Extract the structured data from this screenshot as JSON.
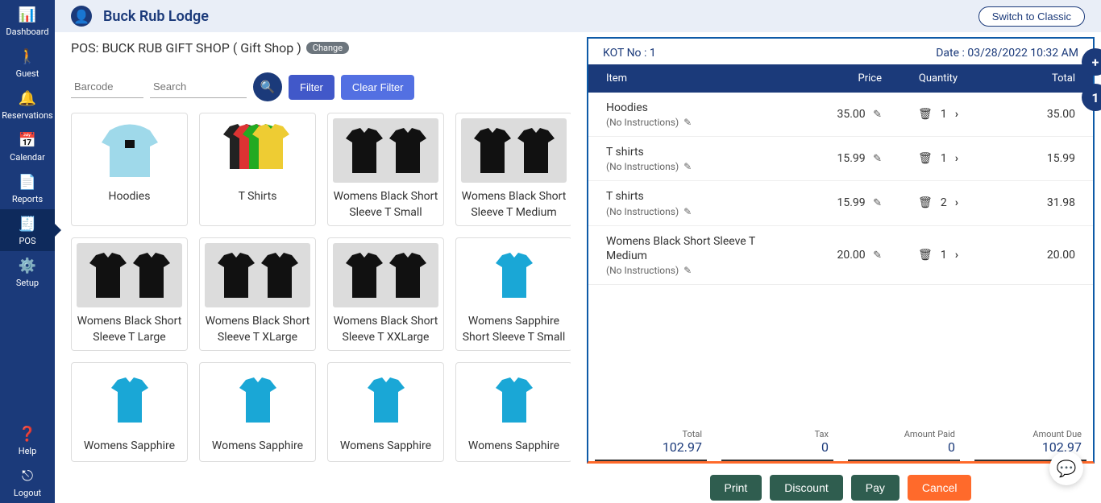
{
  "header": {
    "title": "Buck Rub Lodge",
    "switch_label": "Switch to Classic"
  },
  "sidebar": {
    "items": [
      {
        "label": "Dashboard"
      },
      {
        "label": "Guest"
      },
      {
        "label": "Reservations"
      },
      {
        "label": "Calendar"
      },
      {
        "label": "Reports"
      },
      {
        "label": "POS"
      },
      {
        "label": "Setup"
      }
    ],
    "bottom": [
      {
        "label": "Help"
      },
      {
        "label": "Logout"
      }
    ]
  },
  "pos_line": {
    "prefix": "POS: BUCK RUB GIFT SHOP ( Gift Shop )",
    "change": "Change"
  },
  "search": {
    "barcode_ph": "Barcode",
    "search_ph": "Search",
    "filter": "Filter",
    "clear": "Clear Filter"
  },
  "products": [
    {
      "label": "Hoodies",
      "img": "hoodie"
    },
    {
      "label": "T Shirts",
      "img": "multi"
    },
    {
      "label": "Womens Black Short Sleeve T Small",
      "img": "blackpair"
    },
    {
      "label": "Womens Black Short Sleeve T Medium",
      "img": "blackpair"
    },
    {
      "label": "Womens Black Short Sleeve T Large",
      "img": "blackpair"
    },
    {
      "label": "Womens Black Short Sleeve T XLarge",
      "img": "blackpair"
    },
    {
      "label": "Womens Black Short Sleeve T XXLarge",
      "img": "blackpair"
    },
    {
      "label": "Womens Sapphire Short Sleeve T Small",
      "img": "sapphire"
    },
    {
      "label": "Womens Sapphire",
      "img": "sapphire"
    },
    {
      "label": "Womens Sapphire",
      "img": "sapphire"
    },
    {
      "label": "Womens Sapphire",
      "img": "sapphire"
    },
    {
      "label": "Womens Sapphire",
      "img": "sapphire"
    }
  ],
  "kot": {
    "kot_no_label": "KOT No : 1",
    "date_label": "Date : 03/28/2022 10:32 AM",
    "headers": {
      "item": "Item",
      "price": "Price",
      "qty": "Quantity",
      "total": "Total"
    },
    "rows": [
      {
        "name": "Hoodies",
        "instr": "(No Instructions)",
        "price": "35.00",
        "qty": "1",
        "total": "35.00"
      },
      {
        "name": "T shirts",
        "instr": "(No Instructions)",
        "price": "15.99",
        "qty": "1",
        "total": "15.99"
      },
      {
        "name": "T shirts",
        "instr": "(No Instructions)",
        "price": "15.99",
        "qty": "2",
        "total": "31.98"
      },
      {
        "name": "Womens Black Short Sleeve T Medium",
        "instr": "(No Instructions)",
        "price": "20.00",
        "qty": "1",
        "total": "20.00"
      }
    ]
  },
  "totals": {
    "total": {
      "lbl": "Total",
      "val": "102.97"
    },
    "tax": {
      "lbl": "Tax",
      "val": "0"
    },
    "paid": {
      "lbl": "Amount Paid",
      "val": "0"
    },
    "due": {
      "lbl": "Amount Due",
      "val": "102.97"
    }
  },
  "actions": {
    "print": "Print",
    "discount": "Discount",
    "pay": "Pay",
    "cancel": "Cancel"
  },
  "side": {
    "plus": "+",
    "one": "1"
  }
}
